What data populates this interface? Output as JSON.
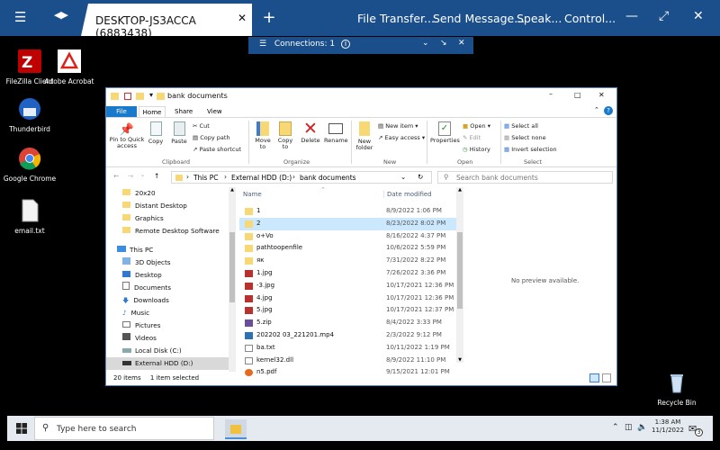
{
  "topbar": {
    "tab_title": "DESKTOP-JS3ACCA (6883438)",
    "menu_items": [
      "File Transfer...",
      "Send Message...",
      "Speak...",
      "Control..."
    ]
  },
  "connections": {
    "label": "Connections: 1",
    "info": "i"
  },
  "desktop_icons": [
    {
      "label": "FileZilla Client"
    },
    {
      "label": "Adobe Acrobat"
    },
    {
      "label": "Thunderbird"
    },
    {
      "label": "Google Chrome"
    },
    {
      "label": "email.txt"
    },
    {
      "label": "Recycle Bin"
    }
  ],
  "explorer": {
    "title": "bank documents",
    "tabs": [
      "File",
      "Home",
      "Share",
      "View"
    ],
    "ribbon": {
      "clipboard": {
        "pin": "Pin to Quick access",
        "copy": "Copy",
        "paste": "Paste",
        "cut": "Cut",
        "copy_path": "Copy path",
        "paste_shortcut": "Paste shortcut",
        "group": "Clipboard"
      },
      "organize": {
        "move": "Move to",
        "copy": "Copy to",
        "delete": "Delete",
        "rename": "Rename",
        "group": "Organize"
      },
      "new": {
        "folder": "New folder",
        "item": "New item",
        "easy": "Easy access",
        "group": "New"
      },
      "open": {
        "properties": "Properties",
        "open": "Open",
        "edit": "Edit",
        "history": "History",
        "group": "Open"
      },
      "select": {
        "all": "Select all",
        "none": "Select none",
        "invert": "Invert selection",
        "group": "Select"
      }
    },
    "address": {
      "segments": [
        "This PC",
        "External HDD (D:)",
        "bank documents"
      ],
      "search_placeholder": "Search bank documents"
    },
    "nav": {
      "items": [
        "20x20",
        "Distant Desktop",
        "Graphics",
        "Remote Desktop Software",
        "This PC",
        "3D Objects",
        "Desktop",
        "Documents",
        "Downloads",
        "Music",
        "Pictures",
        "Videos",
        "Local Disk (C:)",
        "External HDD (D:)"
      ]
    },
    "columns": {
      "name": "Name",
      "date": "Date modified"
    },
    "files": [
      {
        "name": "1",
        "date": "8/9/2022 1:06 PM",
        "type": "folder"
      },
      {
        "name": "2",
        "date": "8/23/2022 8:02 PM",
        "type": "folder"
      },
      {
        "name": "o+Vo",
        "date": "8/16/2022 4:37 PM",
        "type": "folder"
      },
      {
        "name": "pathtoopenfile",
        "date": "10/6/2022 5:59 PM",
        "type": "folder"
      },
      {
        "name": "як",
        "date": "7/31/2022 8:22 PM",
        "type": "folder"
      },
      {
        "name": "1.jpg",
        "date": "7/26/2022 3:36 PM",
        "type": "image"
      },
      {
        "name": "-3.jpg",
        "date": "10/17/2021 12:36 PM",
        "type": "image"
      },
      {
        "name": "4.jpg",
        "date": "10/17/2021 12:36 PM",
        "type": "image"
      },
      {
        "name": "5.jpg",
        "date": "10/17/2021 12:37 PM",
        "type": "image"
      },
      {
        "name": "5.zip",
        "date": "8/4/2022 3:33 PM",
        "type": "zip"
      },
      {
        "name": "202202 03_221201.mp4",
        "date": "2/3/2022 9:12 PM",
        "type": "video"
      },
      {
        "name": "ba.txt",
        "date": "10/11/2022 1:19 PM",
        "type": "text"
      },
      {
        "name": "kernel32.dll",
        "date": "8/9/2022 11:10 PM",
        "type": "dll"
      },
      {
        "name": "n5.pdf",
        "date": "9/15/2021 12:01 PM",
        "type": "pdf"
      }
    ],
    "preview_text": "No preview available.",
    "status": {
      "items": "20 items",
      "selected": "1 item selected"
    }
  },
  "taskbar": {
    "search_placeholder": "Type here to search",
    "time": "1:38 AM",
    "date": "11/1/2022",
    "notification_count": "3"
  },
  "colors": {
    "topbar": "#1a4f8c",
    "desktop": "#000000",
    "selection": "#cce8ff",
    "folder": "#f8d775"
  }
}
